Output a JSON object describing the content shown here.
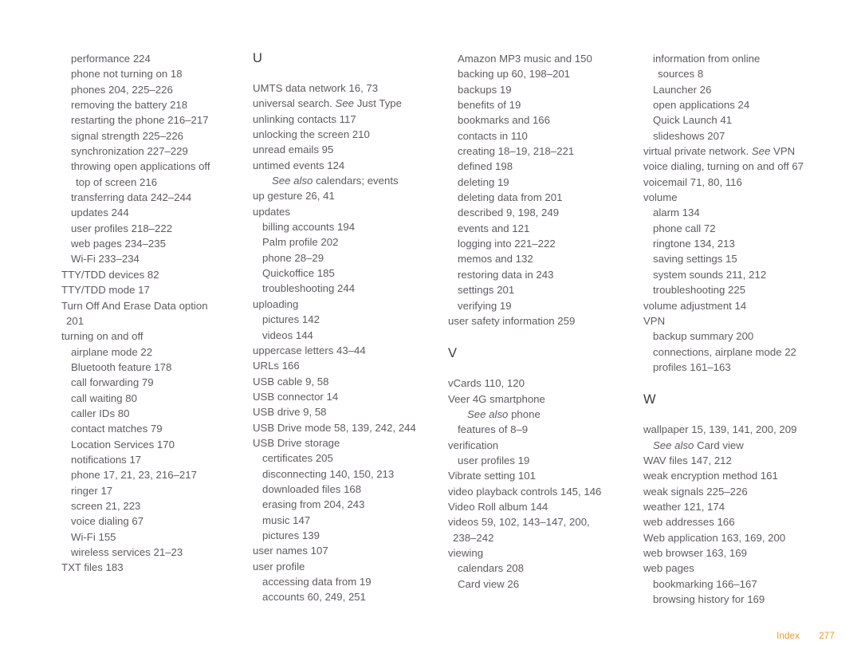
{
  "page": {
    "footer_label": "Index",
    "page_number": "277",
    "accent_color": "#f0962e",
    "text_color": "#5f5a63",
    "heading_color": "#3d3a40"
  },
  "columns": [
    {
      "id": "column-1",
      "blocks": [
        {
          "type": "entries",
          "entries": [
            {
              "level": 1,
              "text": "performance 224"
            },
            {
              "level": 1,
              "text": "phone not turning on 18"
            },
            {
              "level": 1,
              "text": "phones 204, 225–226"
            },
            {
              "level": 1,
              "text": "removing the battery 218"
            },
            {
              "level": 1,
              "text": "restarting the phone 216–217"
            },
            {
              "level": 1,
              "text": "signal strength 225–226"
            },
            {
              "level": 1,
              "text": "synchronization 227–229"
            },
            {
              "level": 1,
              "text": "throwing open applications off"
            },
            {
              "level": "cont-1",
              "text": "top of screen 216"
            },
            {
              "level": 1,
              "text": "transferring data 242–244"
            },
            {
              "level": 1,
              "text": "updates 244"
            },
            {
              "level": 1,
              "text": "user profiles 218–222"
            },
            {
              "level": 1,
              "text": "web pages 234–235"
            },
            {
              "level": 1,
              "text": "Wi-Fi 233–234"
            },
            {
              "level": 0,
              "text": "TTY/TDD devices 82"
            },
            {
              "level": 0,
              "text": "TTY/TDD mode 17"
            },
            {
              "level": 0,
              "text": "Turn Off And Erase Data option"
            },
            {
              "level": "cont-0",
              "text": "201"
            },
            {
              "level": 0,
              "text": "turning on and off"
            },
            {
              "level": 1,
              "text": "airplane mode 22"
            },
            {
              "level": 1,
              "text": "Bluetooth feature 178"
            },
            {
              "level": 1,
              "text": "call forwarding 79"
            },
            {
              "level": 1,
              "text": "call waiting 80"
            },
            {
              "level": 1,
              "text": "caller IDs 80"
            },
            {
              "level": 1,
              "text": "contact matches 79"
            },
            {
              "level": 1,
              "text": "Location Services 170"
            },
            {
              "level": 1,
              "text": "notifications 17"
            },
            {
              "level": 1,
              "text": "phone 17, 21, 23, 216–217"
            },
            {
              "level": 1,
              "text": "ringer 17"
            },
            {
              "level": 1,
              "text": "screen 21, 223"
            },
            {
              "level": 1,
              "text": "voice dialing 67"
            },
            {
              "level": 1,
              "text": "Wi-Fi 155"
            },
            {
              "level": 1,
              "text": "wireless services 21–23"
            },
            {
              "level": 0,
              "text": "TXT files 183"
            }
          ]
        }
      ]
    },
    {
      "id": "column-2",
      "blocks": [
        {
          "type": "heading",
          "letter": "U",
          "first": true
        },
        {
          "type": "entries",
          "entries": [
            {
              "level": 0,
              "text": "UMTS data network 16, 73"
            },
            {
              "level": 0,
              "text": "universal search. See Just Type",
              "italic_prefix": "See",
              "plain_suffix": " Just Type",
              "lead": "universal search. "
            },
            {
              "level": 0,
              "text": "unlinking contacts 117"
            },
            {
              "level": 0,
              "text": "unlocking the screen 210"
            },
            {
              "level": 0,
              "text": "unread emails 95"
            },
            {
              "level": 0,
              "text": "untimed events 124"
            },
            {
              "level": "see-also",
              "text": "See also calendars; events",
              "italic_prefix": "See also",
              "plain_suffix": " calendars; events"
            },
            {
              "level": 0,
              "text": "up gesture 26, 41"
            },
            {
              "level": 0,
              "text": "updates"
            },
            {
              "level": 1,
              "text": "billing accounts 194"
            },
            {
              "level": 1,
              "text": "Palm profile 202"
            },
            {
              "level": 1,
              "text": "phone 28–29"
            },
            {
              "level": 1,
              "text": "Quickoffice 185"
            },
            {
              "level": 1,
              "text": "troubleshooting 244"
            },
            {
              "level": 0,
              "text": "uploading"
            },
            {
              "level": 1,
              "text": "pictures 142"
            },
            {
              "level": 1,
              "text": "videos 144"
            },
            {
              "level": 0,
              "text": "uppercase letters 43–44"
            },
            {
              "level": 0,
              "text": "URLs 166"
            },
            {
              "level": 0,
              "text": "USB cable 9, 58"
            },
            {
              "level": 0,
              "text": "USB connector 14"
            },
            {
              "level": 0,
              "text": "USB drive 9, 58"
            },
            {
              "level": 0,
              "text": "USB Drive mode 58, 139, 242, 244"
            },
            {
              "level": 0,
              "text": "USB Drive storage"
            },
            {
              "level": 1,
              "text": "certificates 205"
            },
            {
              "level": 1,
              "text": "disconnecting 140, 150, 213"
            },
            {
              "level": 1,
              "text": "downloaded files 168"
            },
            {
              "level": 1,
              "text": "erasing from 204, 243"
            },
            {
              "level": 1,
              "text": "music 147"
            },
            {
              "level": 1,
              "text": "pictures 139"
            },
            {
              "level": 0,
              "text": "user names 107"
            },
            {
              "level": 0,
              "text": "user profile"
            },
            {
              "level": 1,
              "text": "accessing data from 19"
            },
            {
              "level": 1,
              "text": "accounts 60, 249, 251"
            }
          ]
        }
      ]
    },
    {
      "id": "column-3",
      "blocks": [
        {
          "type": "entries",
          "entries": [
            {
              "level": 1,
              "text": "Amazon MP3 music and 150"
            },
            {
              "level": 1,
              "text": "backing up 60, 198–201"
            },
            {
              "level": 1,
              "text": "backups 19"
            },
            {
              "level": 1,
              "text": "benefits of 19"
            },
            {
              "level": 1,
              "text": "bookmarks and 166"
            },
            {
              "level": 1,
              "text": "contacts in 110"
            },
            {
              "level": 1,
              "text": "creating 18–19, 218–221"
            },
            {
              "level": 1,
              "text": "defined 198"
            },
            {
              "level": 1,
              "text": "deleting 19"
            },
            {
              "level": 1,
              "text": "deleting data from 201"
            },
            {
              "level": 1,
              "text": "described 9, 198, 249"
            },
            {
              "level": 1,
              "text": "events and 121"
            },
            {
              "level": 1,
              "text": "logging into 221–222"
            },
            {
              "level": 1,
              "text": "memos and 132"
            },
            {
              "level": 1,
              "text": "restoring data in 243"
            },
            {
              "level": 1,
              "text": "settings 201"
            },
            {
              "level": 1,
              "text": "verifying 19"
            },
            {
              "level": 0,
              "text": "user safety information 259"
            }
          ]
        },
        {
          "type": "heading",
          "letter": "V",
          "first": false
        },
        {
          "type": "entries",
          "entries": [
            {
              "level": 0,
              "text": "vCards 110, 120"
            },
            {
              "level": 0,
              "text": "Veer 4G smartphone"
            },
            {
              "level": "see-also",
              "text": "See also phone",
              "italic_prefix": "See also",
              "plain_suffix": " phone"
            },
            {
              "level": 1,
              "text": "features of 8–9"
            },
            {
              "level": 0,
              "text": "verification"
            },
            {
              "level": 1,
              "text": "user profiles 19"
            },
            {
              "level": 0,
              "text": "Vibrate setting 101"
            },
            {
              "level": 0,
              "text": "video playback controls 145, 146"
            },
            {
              "level": 0,
              "text": "Video Roll album 144"
            },
            {
              "level": 0,
              "text": "videos 59, 102, 143–147, 200,"
            },
            {
              "level": "cont-0",
              "text": "238–242"
            },
            {
              "level": 0,
              "text": "viewing"
            },
            {
              "level": 1,
              "text": "calendars 208"
            },
            {
              "level": 1,
              "text": "Card view 26"
            }
          ]
        }
      ]
    },
    {
      "id": "column-4",
      "blocks": [
        {
          "type": "entries",
          "entries": [
            {
              "level": 1,
              "text": "information from online"
            },
            {
              "level": "cont-1",
              "text": "sources 8"
            },
            {
              "level": 1,
              "text": "Launcher 26"
            },
            {
              "level": 1,
              "text": "open applications 24"
            },
            {
              "level": 1,
              "text": "Quick Launch 41"
            },
            {
              "level": 1,
              "text": "slideshows 207"
            },
            {
              "level": 0,
              "text": "virtual private network. See VPN",
              "italic_prefix": "See",
              "plain_suffix": " VPN",
              "lead": "virtual private network. "
            },
            {
              "level": 0,
              "text": "voice dialing, turning on and off 67"
            },
            {
              "level": 0,
              "text": "voicemail 71, 80, 116"
            },
            {
              "level": 0,
              "text": "volume"
            },
            {
              "level": 1,
              "text": "alarm 134"
            },
            {
              "level": 1,
              "text": "phone call 72"
            },
            {
              "level": 1,
              "text": "ringtone 134, 213"
            },
            {
              "level": 1,
              "text": "saving settings 15"
            },
            {
              "level": 1,
              "text": "system sounds 211, 212"
            },
            {
              "level": 1,
              "text": "troubleshooting 225"
            },
            {
              "level": 0,
              "text": "volume adjustment 14"
            },
            {
              "level": 0,
              "text": "VPN"
            },
            {
              "level": 1,
              "text": "backup summary 200"
            },
            {
              "level": 1,
              "text": "connections, airplane mode 22"
            },
            {
              "level": 1,
              "text": "profiles 161–163"
            }
          ]
        },
        {
          "type": "heading",
          "letter": "W",
          "first": false
        },
        {
          "type": "entries",
          "entries": [
            {
              "level": 0,
              "text": "wallpaper 15, 139, 141, 200, 209"
            },
            {
              "level": "see-also-1",
              "text": "See also Card view",
              "italic_prefix": "See also",
              "plain_suffix": " Card view"
            },
            {
              "level": 0,
              "text": "WAV files 147, 212"
            },
            {
              "level": 0,
              "text": "weak encryption method 161"
            },
            {
              "level": 0,
              "text": "weak signals 225–226"
            },
            {
              "level": 0,
              "text": "weather 121, 174"
            },
            {
              "level": 0,
              "text": "web addresses 166"
            },
            {
              "level": 0,
              "text": "Web application 163, 169, 200"
            },
            {
              "level": 0,
              "text": "web browser 163, 169"
            },
            {
              "level": 0,
              "text": "web pages"
            },
            {
              "level": 1,
              "text": "bookmarking 166–167"
            },
            {
              "level": 1,
              "text": "browsing history for 169"
            }
          ]
        }
      ]
    }
  ]
}
